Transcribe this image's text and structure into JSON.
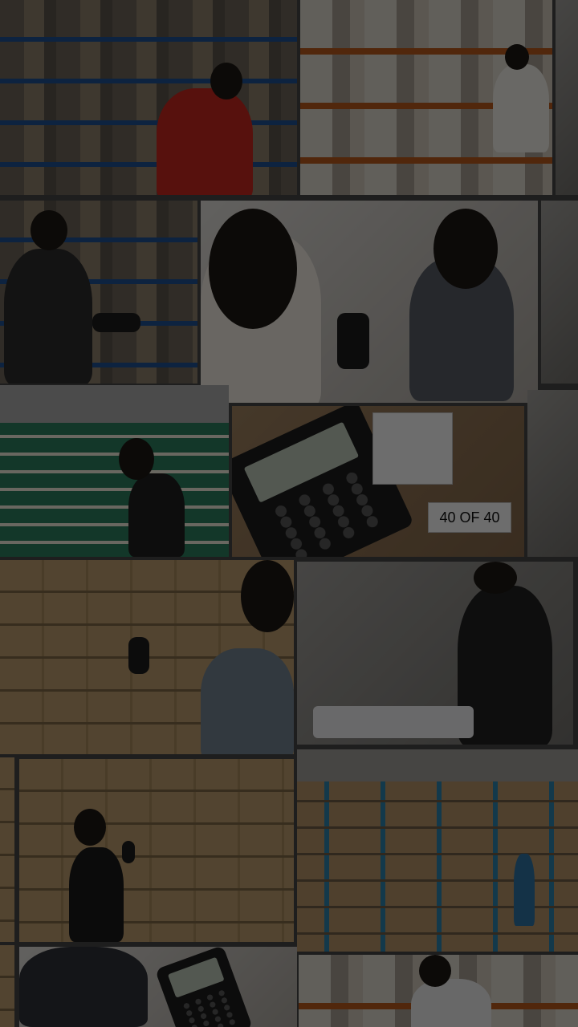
{
  "collage": {
    "label_40_of_40": "40 OF 40"
  },
  "colors": {
    "overlay": "rgba(0,0,0,0.55)",
    "background": "#3c3c3c"
  }
}
